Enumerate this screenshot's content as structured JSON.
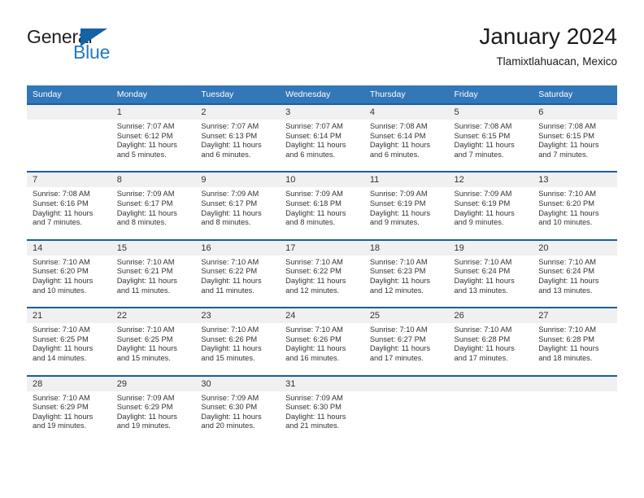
{
  "brand": {
    "name_part1": "General",
    "name_part2": "Blue",
    "triangle_color": "#1464a5",
    "blue_color": "#1f7bc1",
    "dark_color": "#231f20",
    "logo_icon": "triangle-logo-icon"
  },
  "header": {
    "title": "January 2024",
    "subtitle": "Tlamixtlahuacan, Mexico"
  },
  "colors": {
    "header_row_bg": "#3277b8",
    "week_separator": "#1a5fa0",
    "daynum_bg": "#f0f0f0",
    "text": "#333333"
  },
  "calendar": {
    "columns": [
      "Sunday",
      "Monday",
      "Tuesday",
      "Wednesday",
      "Thursday",
      "Friday",
      "Saturday"
    ],
    "weeks": [
      {
        "days": [
          {
            "num": "",
            "sunrise": "",
            "sunset": "",
            "daylight_line1": "",
            "daylight_line2": ""
          },
          {
            "num": "1",
            "sunrise": "Sunrise: 7:07 AM",
            "sunset": "Sunset: 6:12 PM",
            "daylight_line1": "Daylight: 11 hours",
            "daylight_line2": "and 5 minutes."
          },
          {
            "num": "2",
            "sunrise": "Sunrise: 7:07 AM",
            "sunset": "Sunset: 6:13 PM",
            "daylight_line1": "Daylight: 11 hours",
            "daylight_line2": "and 6 minutes."
          },
          {
            "num": "3",
            "sunrise": "Sunrise: 7:07 AM",
            "sunset": "Sunset: 6:14 PM",
            "daylight_line1": "Daylight: 11 hours",
            "daylight_line2": "and 6 minutes."
          },
          {
            "num": "4",
            "sunrise": "Sunrise: 7:08 AM",
            "sunset": "Sunset: 6:14 PM",
            "daylight_line1": "Daylight: 11 hours",
            "daylight_line2": "and 6 minutes."
          },
          {
            "num": "5",
            "sunrise": "Sunrise: 7:08 AM",
            "sunset": "Sunset: 6:15 PM",
            "daylight_line1": "Daylight: 11 hours",
            "daylight_line2": "and 7 minutes."
          },
          {
            "num": "6",
            "sunrise": "Sunrise: 7:08 AM",
            "sunset": "Sunset: 6:15 PM",
            "daylight_line1": "Daylight: 11 hours",
            "daylight_line2": "and 7 minutes."
          }
        ]
      },
      {
        "days": [
          {
            "num": "7",
            "sunrise": "Sunrise: 7:08 AM",
            "sunset": "Sunset: 6:16 PM",
            "daylight_line1": "Daylight: 11 hours",
            "daylight_line2": "and 7 minutes."
          },
          {
            "num": "8",
            "sunrise": "Sunrise: 7:09 AM",
            "sunset": "Sunset: 6:17 PM",
            "daylight_line1": "Daylight: 11 hours",
            "daylight_line2": "and 8 minutes."
          },
          {
            "num": "9",
            "sunrise": "Sunrise: 7:09 AM",
            "sunset": "Sunset: 6:17 PM",
            "daylight_line1": "Daylight: 11 hours",
            "daylight_line2": "and 8 minutes."
          },
          {
            "num": "10",
            "sunrise": "Sunrise: 7:09 AM",
            "sunset": "Sunset: 6:18 PM",
            "daylight_line1": "Daylight: 11 hours",
            "daylight_line2": "and 8 minutes."
          },
          {
            "num": "11",
            "sunrise": "Sunrise: 7:09 AM",
            "sunset": "Sunset: 6:19 PM",
            "daylight_line1": "Daylight: 11 hours",
            "daylight_line2": "and 9 minutes."
          },
          {
            "num": "12",
            "sunrise": "Sunrise: 7:09 AM",
            "sunset": "Sunset: 6:19 PM",
            "daylight_line1": "Daylight: 11 hours",
            "daylight_line2": "and 9 minutes."
          },
          {
            "num": "13",
            "sunrise": "Sunrise: 7:10 AM",
            "sunset": "Sunset: 6:20 PM",
            "daylight_line1": "Daylight: 11 hours",
            "daylight_line2": "and 10 minutes."
          }
        ]
      },
      {
        "days": [
          {
            "num": "14",
            "sunrise": "Sunrise: 7:10 AM",
            "sunset": "Sunset: 6:20 PM",
            "daylight_line1": "Daylight: 11 hours",
            "daylight_line2": "and 10 minutes."
          },
          {
            "num": "15",
            "sunrise": "Sunrise: 7:10 AM",
            "sunset": "Sunset: 6:21 PM",
            "daylight_line1": "Daylight: 11 hours",
            "daylight_line2": "and 11 minutes."
          },
          {
            "num": "16",
            "sunrise": "Sunrise: 7:10 AM",
            "sunset": "Sunset: 6:22 PM",
            "daylight_line1": "Daylight: 11 hours",
            "daylight_line2": "and 11 minutes."
          },
          {
            "num": "17",
            "sunrise": "Sunrise: 7:10 AM",
            "sunset": "Sunset: 6:22 PM",
            "daylight_line1": "Daylight: 11 hours",
            "daylight_line2": "and 12 minutes."
          },
          {
            "num": "18",
            "sunrise": "Sunrise: 7:10 AM",
            "sunset": "Sunset: 6:23 PM",
            "daylight_line1": "Daylight: 11 hours",
            "daylight_line2": "and 12 minutes."
          },
          {
            "num": "19",
            "sunrise": "Sunrise: 7:10 AM",
            "sunset": "Sunset: 6:24 PM",
            "daylight_line1": "Daylight: 11 hours",
            "daylight_line2": "and 13 minutes."
          },
          {
            "num": "20",
            "sunrise": "Sunrise: 7:10 AM",
            "sunset": "Sunset: 6:24 PM",
            "daylight_line1": "Daylight: 11 hours",
            "daylight_line2": "and 13 minutes."
          }
        ]
      },
      {
        "days": [
          {
            "num": "21",
            "sunrise": "Sunrise: 7:10 AM",
            "sunset": "Sunset: 6:25 PM",
            "daylight_line1": "Daylight: 11 hours",
            "daylight_line2": "and 14 minutes."
          },
          {
            "num": "22",
            "sunrise": "Sunrise: 7:10 AM",
            "sunset": "Sunset: 6:25 PM",
            "daylight_line1": "Daylight: 11 hours",
            "daylight_line2": "and 15 minutes."
          },
          {
            "num": "23",
            "sunrise": "Sunrise: 7:10 AM",
            "sunset": "Sunset: 6:26 PM",
            "daylight_line1": "Daylight: 11 hours",
            "daylight_line2": "and 15 minutes."
          },
          {
            "num": "24",
            "sunrise": "Sunrise: 7:10 AM",
            "sunset": "Sunset: 6:26 PM",
            "daylight_line1": "Daylight: 11 hours",
            "daylight_line2": "and 16 minutes."
          },
          {
            "num": "25",
            "sunrise": "Sunrise: 7:10 AM",
            "sunset": "Sunset: 6:27 PM",
            "daylight_line1": "Daylight: 11 hours",
            "daylight_line2": "and 17 minutes."
          },
          {
            "num": "26",
            "sunrise": "Sunrise: 7:10 AM",
            "sunset": "Sunset: 6:28 PM",
            "daylight_line1": "Daylight: 11 hours",
            "daylight_line2": "and 17 minutes."
          },
          {
            "num": "27",
            "sunrise": "Sunrise: 7:10 AM",
            "sunset": "Sunset: 6:28 PM",
            "daylight_line1": "Daylight: 11 hours",
            "daylight_line2": "and 18 minutes."
          }
        ]
      },
      {
        "days": [
          {
            "num": "28",
            "sunrise": "Sunrise: 7:10 AM",
            "sunset": "Sunset: 6:29 PM",
            "daylight_line1": "Daylight: 11 hours",
            "daylight_line2": "and 19 minutes."
          },
          {
            "num": "29",
            "sunrise": "Sunrise: 7:09 AM",
            "sunset": "Sunset: 6:29 PM",
            "daylight_line1": "Daylight: 11 hours",
            "daylight_line2": "and 19 minutes."
          },
          {
            "num": "30",
            "sunrise": "Sunrise: 7:09 AM",
            "sunset": "Sunset: 6:30 PM",
            "daylight_line1": "Daylight: 11 hours",
            "daylight_line2": "and 20 minutes."
          },
          {
            "num": "31",
            "sunrise": "Sunrise: 7:09 AM",
            "sunset": "Sunset: 6:30 PM",
            "daylight_line1": "Daylight: 11 hours",
            "daylight_line2": "and 21 minutes."
          },
          {
            "num": "",
            "sunrise": "",
            "sunset": "",
            "daylight_line1": "",
            "daylight_line2": ""
          },
          {
            "num": "",
            "sunrise": "",
            "sunset": "",
            "daylight_line1": "",
            "daylight_line2": ""
          },
          {
            "num": "",
            "sunrise": "",
            "sunset": "",
            "daylight_line1": "",
            "daylight_line2": ""
          }
        ]
      }
    ]
  }
}
